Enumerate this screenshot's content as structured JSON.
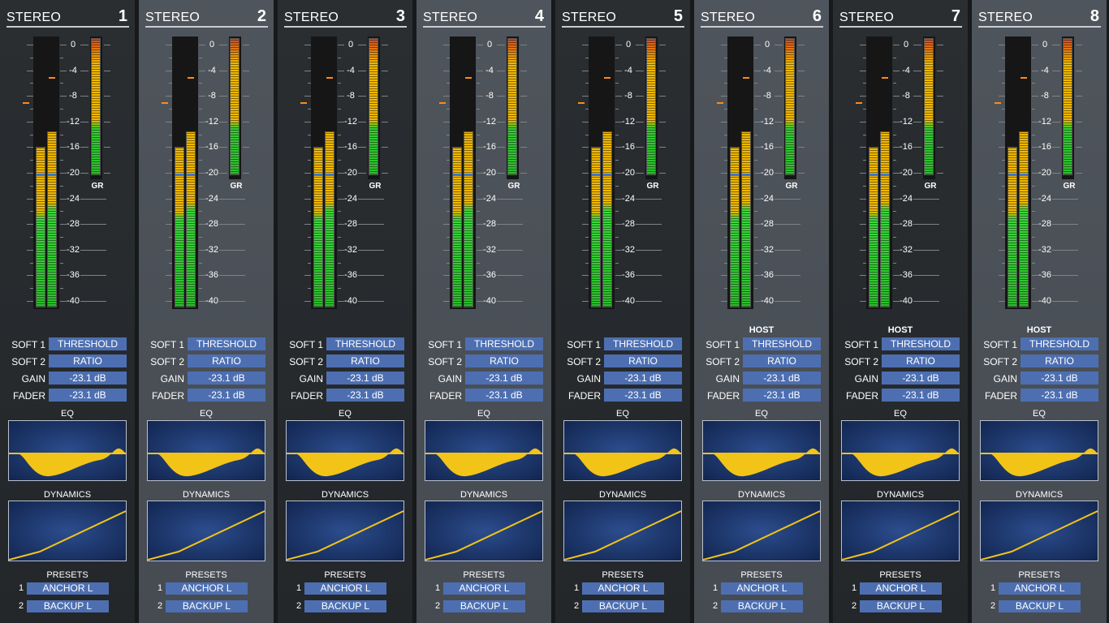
{
  "channels": [
    {
      "number": "1",
      "title": "STEREO",
      "host": ""
    },
    {
      "number": "2",
      "title": "STEREO",
      "host": ""
    },
    {
      "number": "3",
      "title": "STEREO",
      "host": ""
    },
    {
      "number": "4",
      "title": "STEREO",
      "host": ""
    },
    {
      "number": "5",
      "title": "STEREO",
      "host": ""
    },
    {
      "number": "6",
      "title": "STEREO",
      "host": "HOST"
    },
    {
      "number": "7",
      "title": "STEREO",
      "host": "HOST"
    },
    {
      "number": "8",
      "title": "STEREO",
      "host": "HOST"
    }
  ],
  "scale": {
    "main": [
      "0",
      "-4",
      "-8",
      "-12",
      "-16",
      "-20",
      "-24",
      "-28",
      "-32",
      "-36",
      "-40"
    ],
    "gr": "GR"
  },
  "meter_levels": {
    "left_db": -16,
    "right_db": -13.5,
    "peak_left_db": -9,
    "peak_right_db": -5,
    "gr_db": -21
  },
  "controls": {
    "soft1_label": "SOFT 1",
    "soft1_value": "THRESHOLD",
    "soft2_label": "SOFT 2",
    "soft2_value": "RATIO",
    "gain_label": "GAIN",
    "gain_value": "-23.1 dB",
    "fader_label": "FADER",
    "fader_value": "-23.1 dB"
  },
  "sections": {
    "eq": "EQ",
    "dynamics": "DYNAMICS",
    "presets": "PRESETS"
  },
  "presets": [
    {
      "num": "1",
      "name": "ANCHOR L"
    },
    {
      "num": "2",
      "name": "BACKUP L"
    }
  ],
  "colors": {
    "strip_dark": "#262a2d",
    "strip_light": "#4b5057",
    "button": "#4d6fb2",
    "curve": "#f2c418",
    "meter_green": "#2fc52f",
    "meter_yellow": "#f0b800",
    "meter_red": "#d94a1c"
  },
  "icons": {
    "meter": "level-meter-icon",
    "eq": "eq-curve-icon",
    "dynamics": "dynamics-curve-icon"
  }
}
